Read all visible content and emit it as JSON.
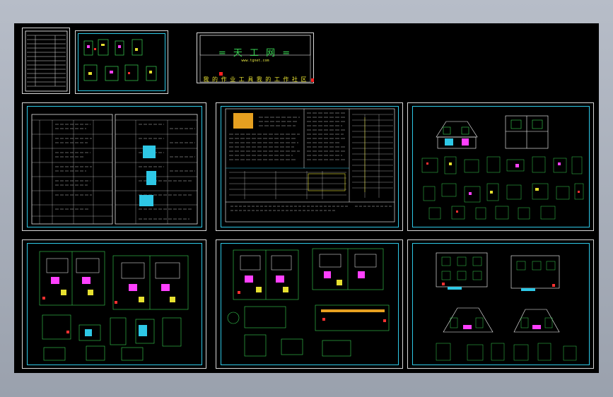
{
  "viewer": {
    "background": "#000000",
    "chrome_color": "#a5acb8",
    "line_colors": [
      "#ffffff",
      "#2ec8e6",
      "#39d353",
      "#e6e030",
      "#ff3030",
      "#ff40ff"
    ]
  },
  "logo": {
    "title": "= 天 工 网 =",
    "url": "www.tgnet.com",
    "slogan": "我 的 作 业 工 具   我 的 工 作 社 区"
  }
}
